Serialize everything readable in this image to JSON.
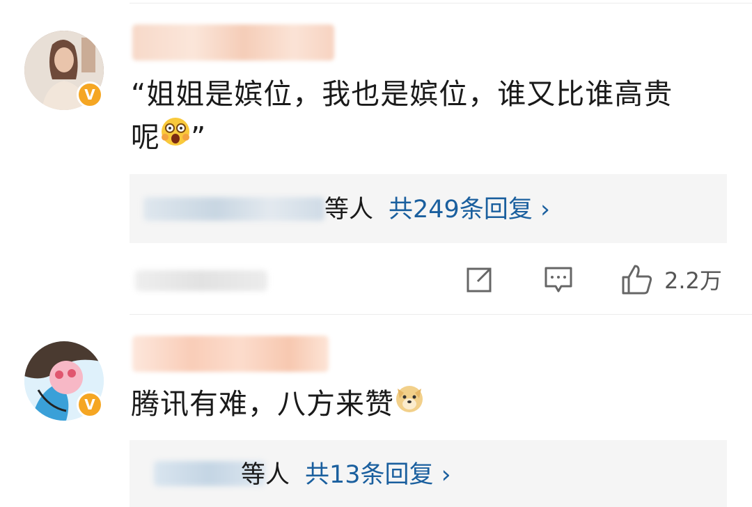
{
  "comments": [
    {
      "text_line1": "“姐姐是嫔位，我也是嫔位，谁又比谁高贵",
      "text_line2": "呢",
      "text_after_emoji": "”",
      "emoji": "astonished-emoji",
      "badge": "V",
      "replies": {
        "by_suffix": "等人",
        "count_label": "共249条回复 ›"
      },
      "actions": {
        "share_icon": "share-icon",
        "comment_icon": "comment-icon",
        "like_icon": "thumbs-up-icon",
        "likes": "2.2万"
      }
    },
    {
      "text": "腾讯有难，八方来赞",
      "emoji": "doge-emoji",
      "badge": "V",
      "replies": {
        "by_suffix": "等人",
        "count_label": "共13条回复 ›"
      }
    }
  ],
  "colors": {
    "link": "#1a5f9e",
    "badge": "#f5a623",
    "reply_bg": "#f5f5f5"
  }
}
